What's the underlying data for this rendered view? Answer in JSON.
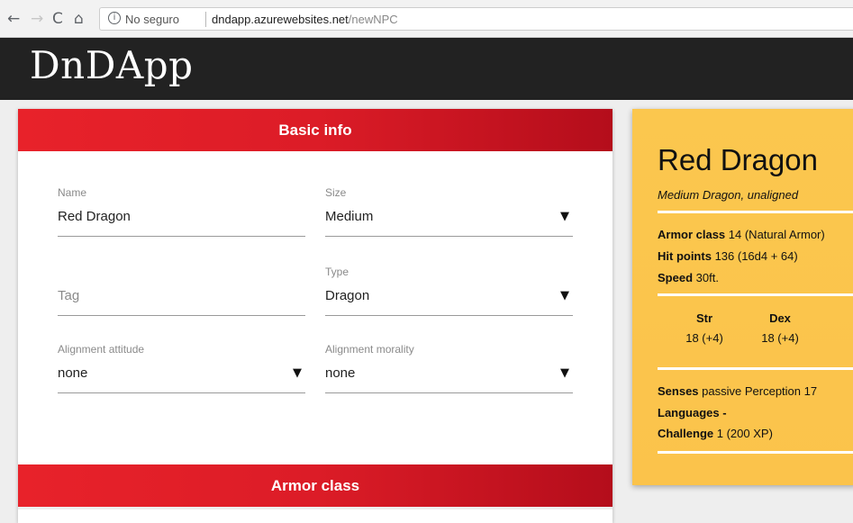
{
  "browser": {
    "nav": {
      "back_icon": "←",
      "forward_icon": "→",
      "reload_icon": "C",
      "home_icon": "⌂"
    },
    "address": {
      "info_glyph": "i",
      "insecure_label": "No seguro",
      "host": "dndapp.azurewebsites.net",
      "path": "/newNPC"
    }
  },
  "app": {
    "logo": "DnDApp"
  },
  "form": {
    "basic_info_title": "Basic info",
    "armor_class_title": "Armor class",
    "fields": {
      "name": {
        "label": "Name",
        "value": "Red Dragon"
      },
      "size": {
        "label": "Size",
        "value": "Medium"
      },
      "tag": {
        "placeholder": "Tag"
      },
      "type": {
        "label": "Type",
        "value": "Dragon"
      },
      "alignment_attitude": {
        "label": "Alignment attitude",
        "value": "none"
      },
      "alignment_morality": {
        "label": "Alignment morality",
        "value": "none"
      }
    },
    "dropdown_caret": "▼"
  },
  "statblock": {
    "name": "Red Dragon",
    "type_line": "Medium Dragon, unaligned",
    "armor_class": {
      "label": "Armor class",
      "value": "14 (Natural Armor)"
    },
    "hit_points": {
      "label": "Hit points",
      "value": "136 (16d4 + 64)"
    },
    "speed": {
      "label": "Speed",
      "value": "30ft."
    },
    "abilities": [
      {
        "name": "Str",
        "value": "18 (+4)"
      },
      {
        "name": "Dex",
        "value": "18 (+4)"
      }
    ],
    "senses": {
      "label": "Senses",
      "value": "passive Perception 17"
    },
    "languages": {
      "label": "Languages",
      "value": "-"
    },
    "challenge": {
      "label": "Challenge",
      "value": "1 (200 XP)"
    }
  },
  "colors": {
    "header_red": "#e8222a",
    "header_dark_red": "#b40d1b",
    "statblock_yellow": "#fbc74e",
    "appbar": "#222222"
  }
}
